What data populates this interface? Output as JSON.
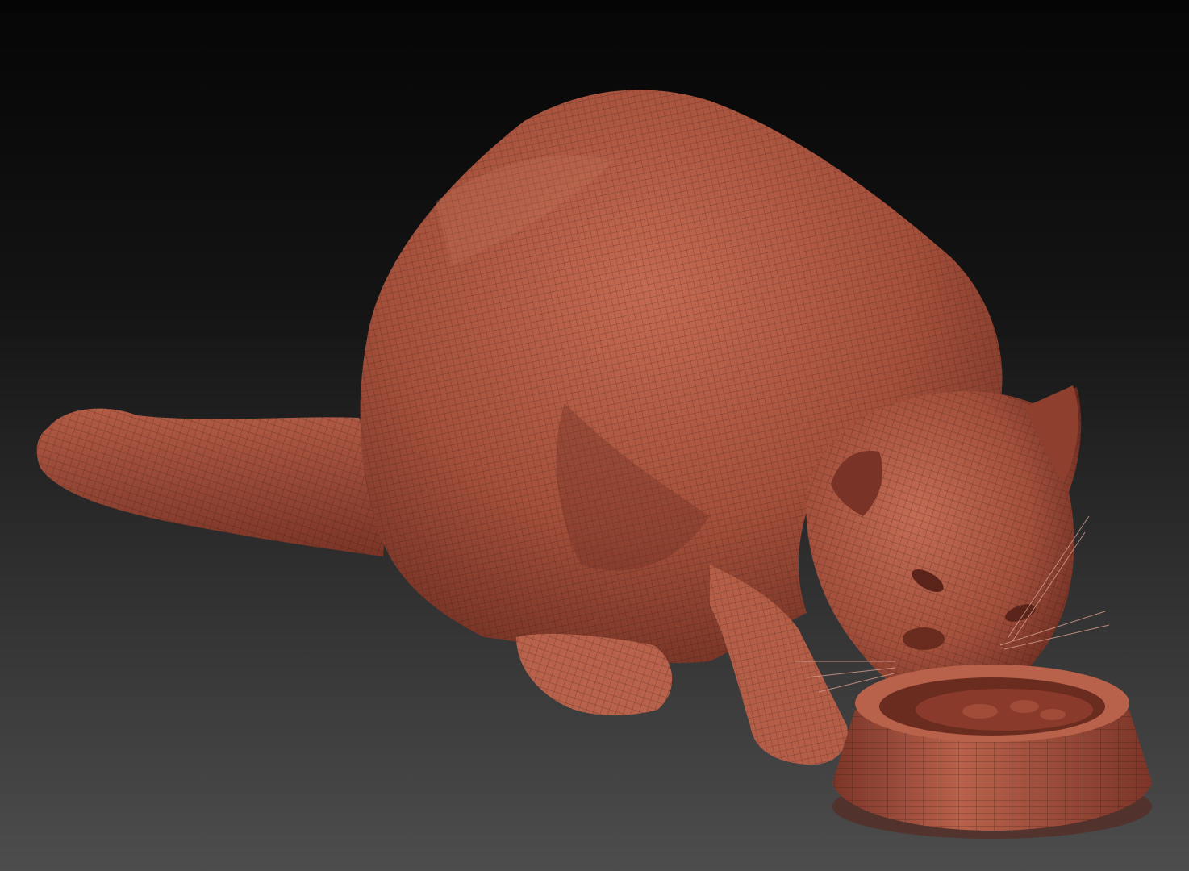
{
  "viewport": {
    "background_top": "#050505",
    "background_bottom": "#4a4a4a"
  },
  "model": {
    "subject": "cat-eating-from-bowl",
    "base_color": "#a7513c",
    "highlight_color": "#c66a52",
    "shadow_color": "#5b261b",
    "wire_color": "#2a120c"
  }
}
